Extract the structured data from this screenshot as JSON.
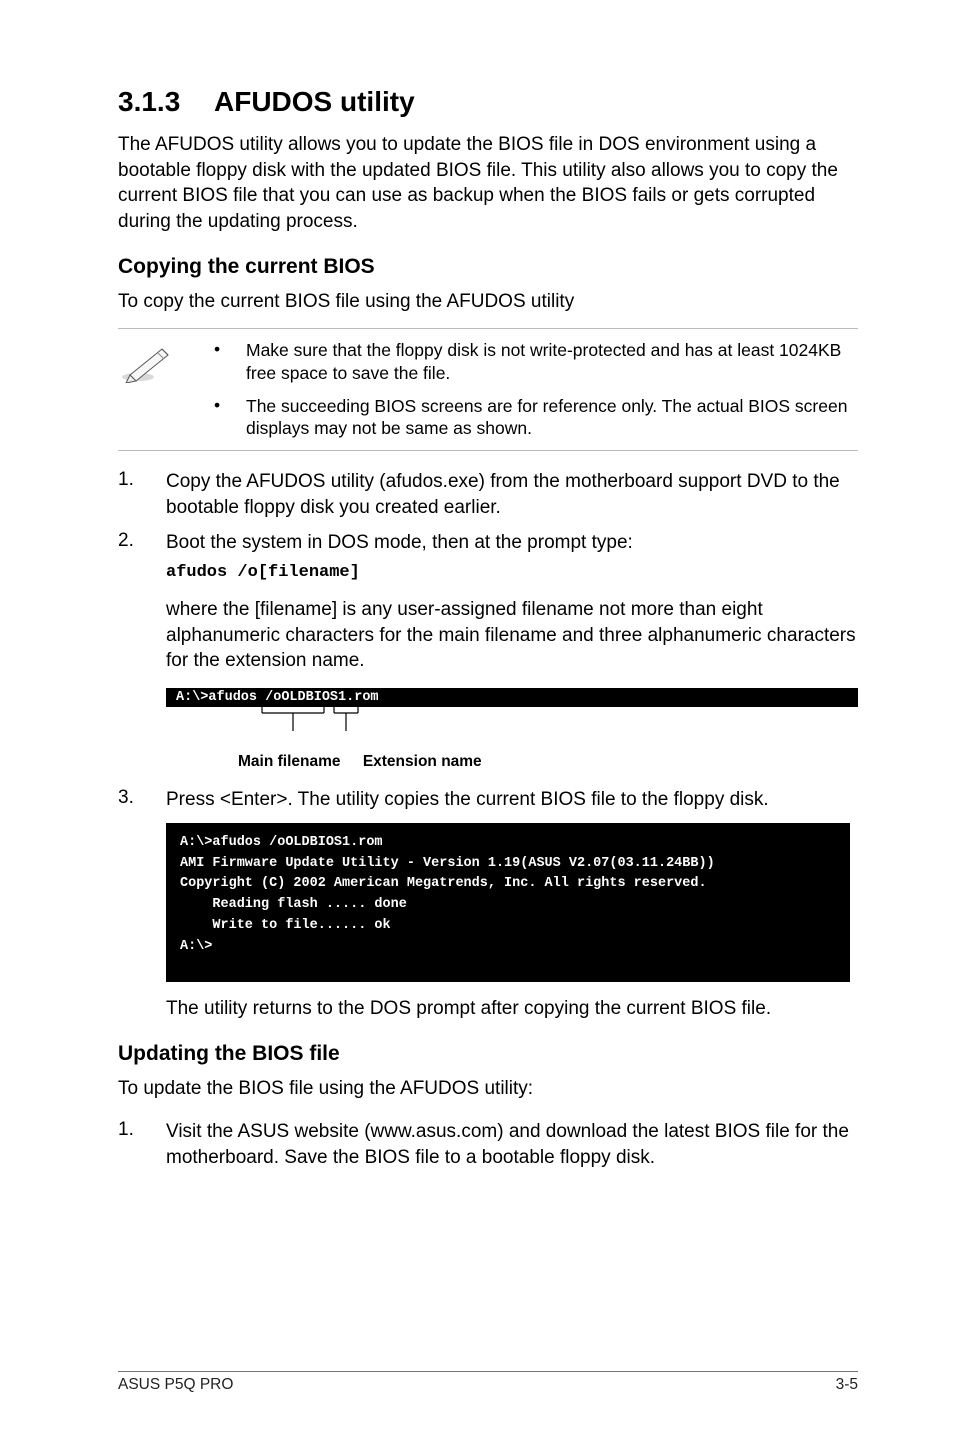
{
  "section": {
    "number": "3.1.3",
    "title": "AFUDOS utility",
    "intro": "The AFUDOS utility allows you to update the BIOS file in DOS environment using a bootable floppy disk with the updated BIOS file. This utility also allows you to copy the current BIOS file that you can use as backup when the BIOS fails or gets corrupted during the updating process."
  },
  "copying": {
    "heading": "Copying the current BIOS",
    "lead": "To copy the current BIOS file using the AFUDOS utility",
    "notes": [
      "Make sure that the floppy disk is not write-protected and has at least 1024KB free space to save the file.",
      "The succeeding BIOS screens are for reference only. The actual BIOS screen displays may not be same as shown."
    ],
    "steps": {
      "s1": {
        "num": "1.",
        "text": "Copy the AFUDOS utility (afudos.exe) from the motherboard support DVD to the bootable floppy disk you created earlier."
      },
      "s2": {
        "num": "2.",
        "text": "Boot the system in DOS mode, then at the prompt type:",
        "cmd": "afudos /o[filename]"
      }
    },
    "where_para": "where the [filename] is any user-assigned filename not more than eight alphanumeric characters  for the main filename and three alphanumeric characters for the extension name.",
    "strip": "A:\\>afudos /oOLDBIOS1.rom",
    "diagram_labels": {
      "main": "Main filename",
      "ext": "Extension name"
    },
    "step3": {
      "num": "3.",
      "text": "Press <Enter>. The utility copies the current BIOS file to the floppy disk."
    },
    "terminal": "A:\\>afudos /oOLDBIOS1.rom\nAMI Firmware Update Utility - Version 1.19(ASUS V2.07(03.11.24BB))\nCopyright (C) 2002 American Megatrends, Inc. All rights reserved.\n    Reading flash ..... done\n    Write to file...... ok\nA:\\>",
    "after_terminal": "The utility returns to the DOS prompt after copying the current BIOS file."
  },
  "updating": {
    "heading": "Updating the BIOS file",
    "lead": "To update the BIOS file using the AFUDOS utility:",
    "step1": {
      "num": "1.",
      "text": "Visit the ASUS website (www.asus.com) and download the latest BIOS file for the motherboard. Save the BIOS file to a bootable floppy disk."
    }
  },
  "footer": {
    "left": "ASUS P5Q PRO",
    "right": "3-5"
  }
}
